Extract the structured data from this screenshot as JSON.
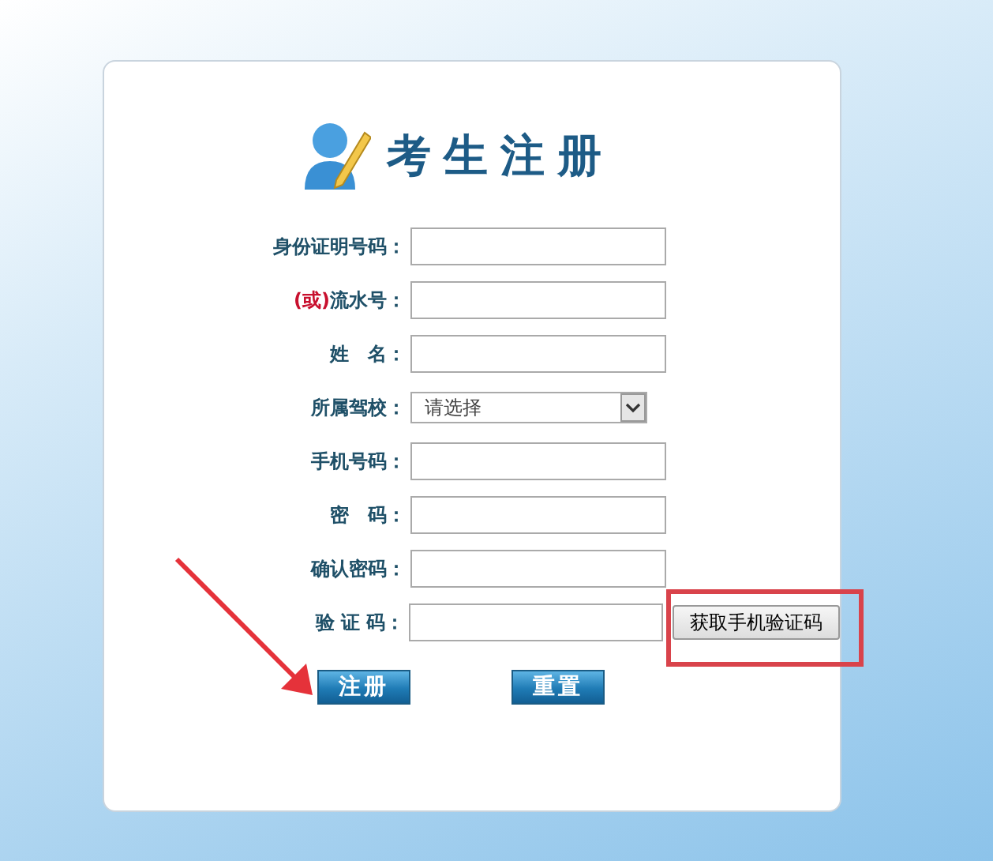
{
  "title": "考生注册",
  "fields": [
    {
      "kind": "input",
      "label": "身份证明号码："
    },
    {
      "kind": "input",
      "prefix": "(或)",
      "label": "流水号："
    },
    {
      "kind": "input",
      "label": "姓　名："
    },
    {
      "kind": "select",
      "label": "所属驾校：",
      "value": "请选择"
    },
    {
      "kind": "input",
      "label": "手机号码："
    },
    {
      "kind": "input",
      "label": "密　码："
    },
    {
      "kind": "input",
      "label": "确认密码："
    },
    {
      "kind": "code",
      "label": "验 证 码：",
      "button": "获取手机验证码"
    }
  ],
  "buttons": [
    "注册",
    "重置"
  ]
}
